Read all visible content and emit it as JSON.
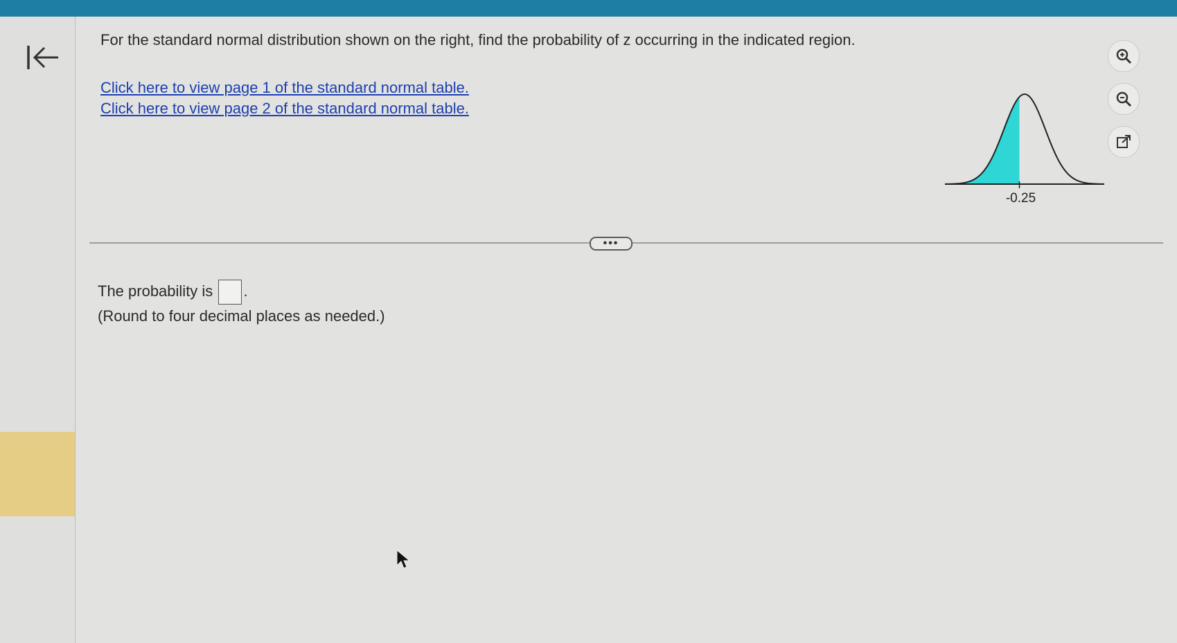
{
  "colors": {
    "top_accent": "#1f7ea3",
    "sidebar_accent": "#e6cd86",
    "shaded_region": "#2fd6d6",
    "link": "#1c3fb0"
  },
  "sidebar": {
    "back_icon": "back-to-start-icon"
  },
  "question": {
    "text": "For the standard normal distribution shown on the right, find the probability of z occurring in the indicated region.",
    "links": [
      {
        "label": "Click here to view page 1 of the standard normal table."
      },
      {
        "label": "Click here to view page 2 of the standard normal table."
      }
    ]
  },
  "figure": {
    "z_value_label": "-0.25",
    "z_value": -0.25,
    "shaded_side": "left"
  },
  "tools": [
    {
      "icon": "zoom-in-icon"
    },
    {
      "icon": "zoom-out-icon"
    },
    {
      "icon": "pop-out-icon"
    }
  ],
  "more_button_label": "•••",
  "answer": {
    "prefix": "The probability is",
    "suffix": ".",
    "value": "",
    "hint": "(Round to four decimal places as needed.)"
  }
}
